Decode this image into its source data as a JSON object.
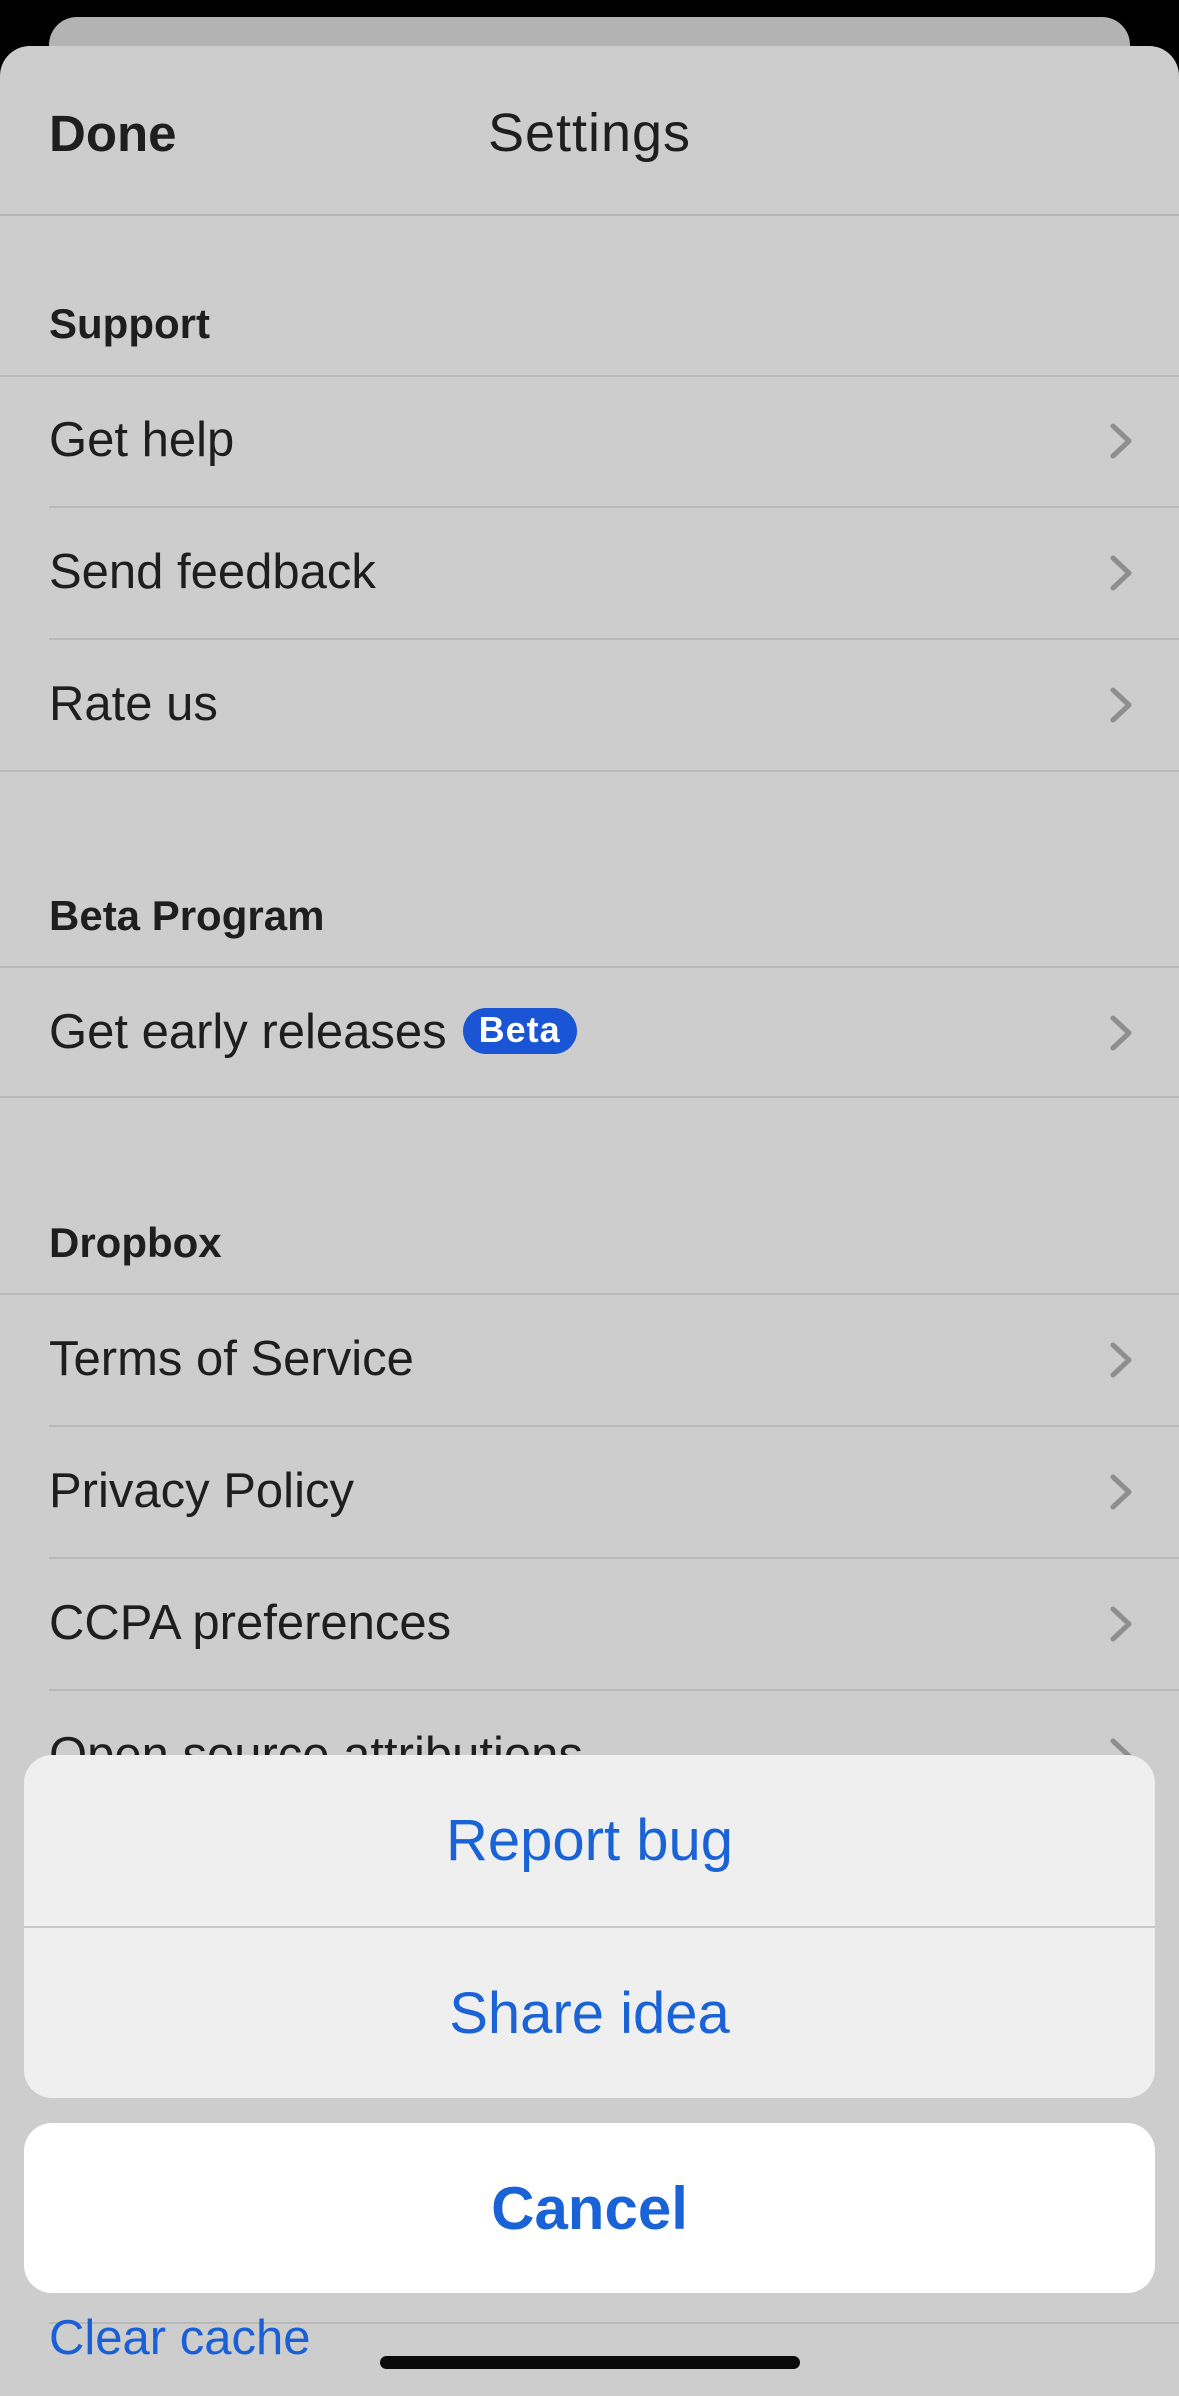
{
  "header": {
    "done_label": "Done",
    "title": "Settings"
  },
  "sections": {
    "support": {
      "title": "Support",
      "items": [
        {
          "label": "Get help"
        },
        {
          "label": "Send feedback"
        },
        {
          "label": "Rate us"
        }
      ]
    },
    "beta": {
      "title": "Beta Program",
      "items": [
        {
          "label": "Get early releases",
          "badge": "Beta"
        }
      ]
    },
    "dropbox": {
      "title": "Dropbox",
      "items": [
        {
          "label": "Terms of Service"
        },
        {
          "label": "Privacy Policy"
        },
        {
          "label": "CCPA preferences"
        },
        {
          "label": "Open source attributions"
        }
      ]
    },
    "partial": {
      "clear_cache": "Clear cache"
    }
  },
  "action_sheet": {
    "actions": [
      {
        "label": "Report bug"
      },
      {
        "label": "Share idea"
      }
    ],
    "cancel_label": "Cancel"
  },
  "colors": {
    "accent": "#1a63d6",
    "badge": "#1a55d6",
    "overlay_bg": "#cdcdcd"
  },
  "icons": {
    "row_chevron": "chevron-right-icon"
  }
}
